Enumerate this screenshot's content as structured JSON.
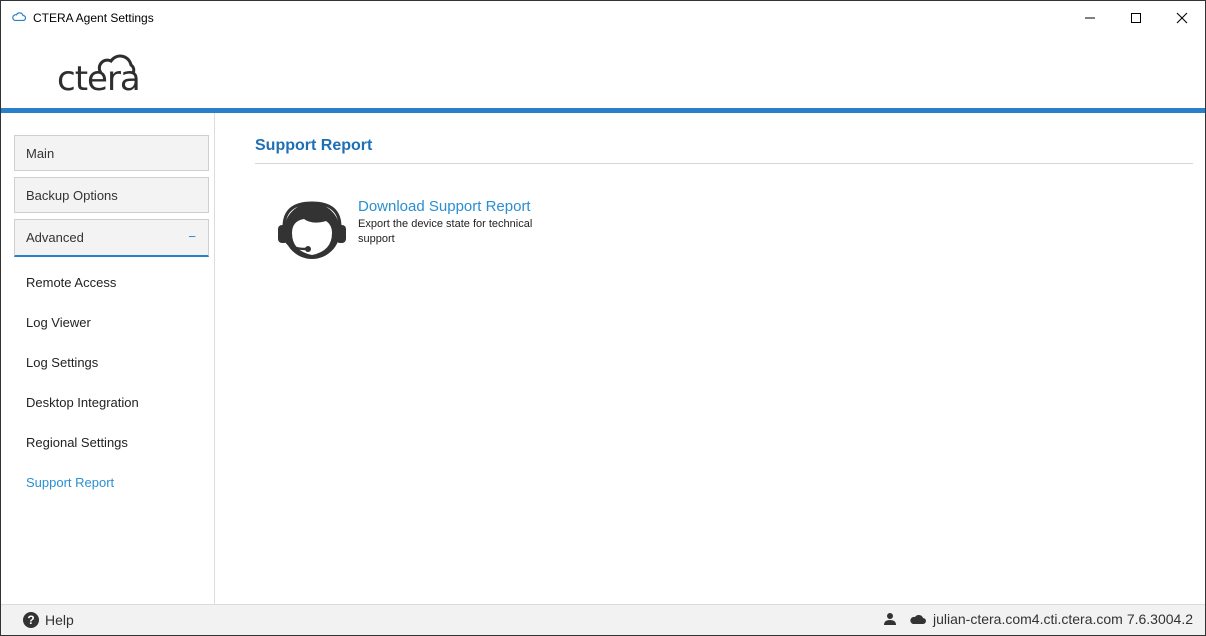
{
  "window": {
    "title": "CTERA Agent Settings",
    "icons": {
      "app": "cloud-icon",
      "minimize": "minimize-icon",
      "maximize": "maximize-icon",
      "close": "close-icon"
    }
  },
  "header": {
    "logo_text": "ctera",
    "accent_color": "#2a7fc9"
  },
  "sidebar": {
    "groups": [
      {
        "label": "Main"
      },
      {
        "label": "Backup Options"
      },
      {
        "label": "Advanced",
        "expanded_symbol": "−"
      }
    ],
    "items": [
      {
        "label": "Remote Access"
      },
      {
        "label": "Log Viewer"
      },
      {
        "label": "Log Settings"
      },
      {
        "label": "Desktop Integration"
      },
      {
        "label": "Regional Settings"
      },
      {
        "label": "Support Report",
        "active": true
      }
    ]
  },
  "content": {
    "title": "Support Report",
    "action": {
      "link": "Download Support Report",
      "description": "Export the device state for technical support",
      "icon": "headset-support-icon"
    }
  },
  "statusbar": {
    "help_label": "Help",
    "server": "julian-ctera.com4.cti.ctera.com",
    "version": "7.6.3004.2",
    "icons": {
      "help": "help-icon",
      "user": "user-icon",
      "cloud": "cloud-icon"
    }
  },
  "colors": {
    "accent": "#2a7fc9",
    "link": "#2a8fd0",
    "title": "#1f6fb5"
  }
}
